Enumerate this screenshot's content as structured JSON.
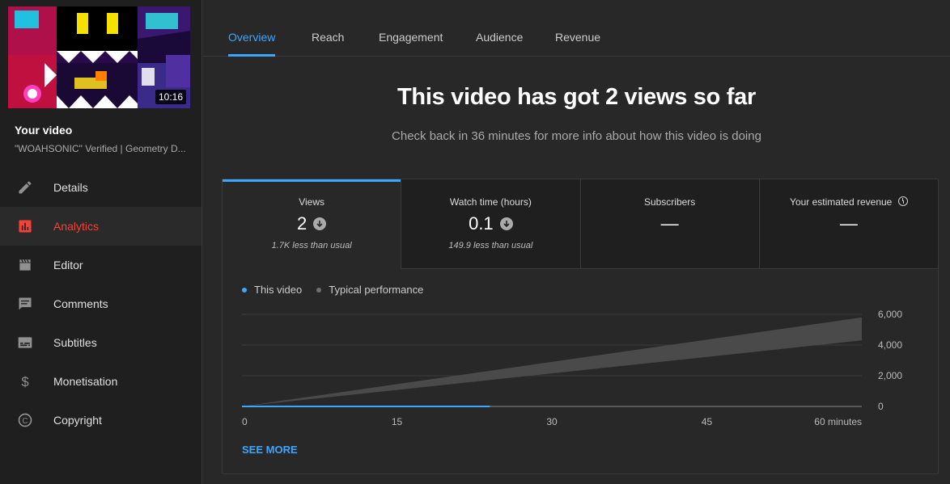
{
  "sidebar": {
    "thumbnail_duration": "10:16",
    "your_video_label": "Your video",
    "video_title": "\"WOAHSONIC\" Verified | Geometry D...",
    "items": [
      {
        "label": "Details",
        "icon": "pencil-icon",
        "active": false
      },
      {
        "label": "Analytics",
        "icon": "analytics-icon",
        "active": true
      },
      {
        "label": "Editor",
        "icon": "clapperboard-icon",
        "active": false
      },
      {
        "label": "Comments",
        "icon": "comment-icon",
        "active": false
      },
      {
        "label": "Subtitles",
        "icon": "subtitles-icon",
        "active": false
      },
      {
        "label": "Monetisation",
        "icon": "dollar-icon",
        "active": false
      },
      {
        "label": "Copyright",
        "icon": "copyright-icon",
        "active": false
      }
    ]
  },
  "tabs": [
    {
      "label": "Overview",
      "active": true
    },
    {
      "label": "Reach"
    },
    {
      "label": "Engagement"
    },
    {
      "label": "Audience"
    },
    {
      "label": "Revenue"
    }
  ],
  "main": {
    "headline": "This video has got 2 views so far",
    "subline": "Check back in 36 minutes for more info about how this video is doing"
  },
  "metrics": [
    {
      "label": "Views",
      "value": "2",
      "note": "1.7K less than usual",
      "trend": "down"
    },
    {
      "label": "Watch time (hours)",
      "value": "0.1",
      "note": "149.9 less than usual",
      "trend": "down"
    },
    {
      "label": "Subscribers",
      "value": "—"
    },
    {
      "label": "Your estimated revenue",
      "value": "—"
    }
  ],
  "legend": {
    "this_video": "This video",
    "typical": "Typical performance"
  },
  "see_more": "SEE MORE",
  "colors": {
    "accent": "#3ea6ff",
    "active_nav": "#f44336",
    "typical_band": "#4a4a4a"
  },
  "chart_data": {
    "type": "area",
    "x_ticks": [
      "0",
      "15",
      "30",
      "45",
      "60 minutes"
    ],
    "y_ticks": [
      "6,000",
      "4,000",
      "2,000",
      "0"
    ],
    "ylim": [
      0,
      6000
    ],
    "xlim": [
      0,
      60
    ],
    "series": [
      {
        "name": "This video",
        "x": [
          0,
          24
        ],
        "y": [
          2,
          2
        ]
      },
      {
        "name": "Typical performance",
        "x": [
          0,
          60
        ],
        "y_low": [
          0,
          4300
        ],
        "y_high": [
          0,
          5800
        ]
      }
    ]
  }
}
